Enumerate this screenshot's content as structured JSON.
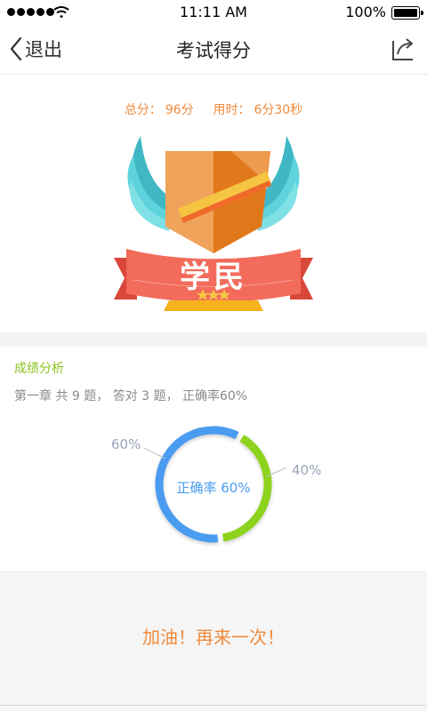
{
  "status_bar": {
    "time": "11:11 AM",
    "battery": "100%"
  },
  "nav": {
    "back_label": "退出",
    "title": "考试得分"
  },
  "score": {
    "total_label": "总分：",
    "total_value": "96分",
    "time_label": "用时：",
    "time_value": "6分30秒"
  },
  "badge": {
    "text": "学民",
    "stars": 3
  },
  "analysis": {
    "title": "成绩分析",
    "summary": "第一章 共 9 题， 答对 3 题， 正确率60%",
    "correct_percent_label": "60%",
    "wrong_percent_label": "40%",
    "center_label": "正确率 60%",
    "correct_fraction": 0.6
  },
  "footer": {
    "retry_label": "加油！再来一次！"
  },
  "colors": {
    "accent_orange": "#f08a3c",
    "green": "#8dc21f",
    "blue": "#4a9cf0",
    "ribbon_red": "#f26b5b",
    "wing_teal": "#4ec9d2"
  }
}
